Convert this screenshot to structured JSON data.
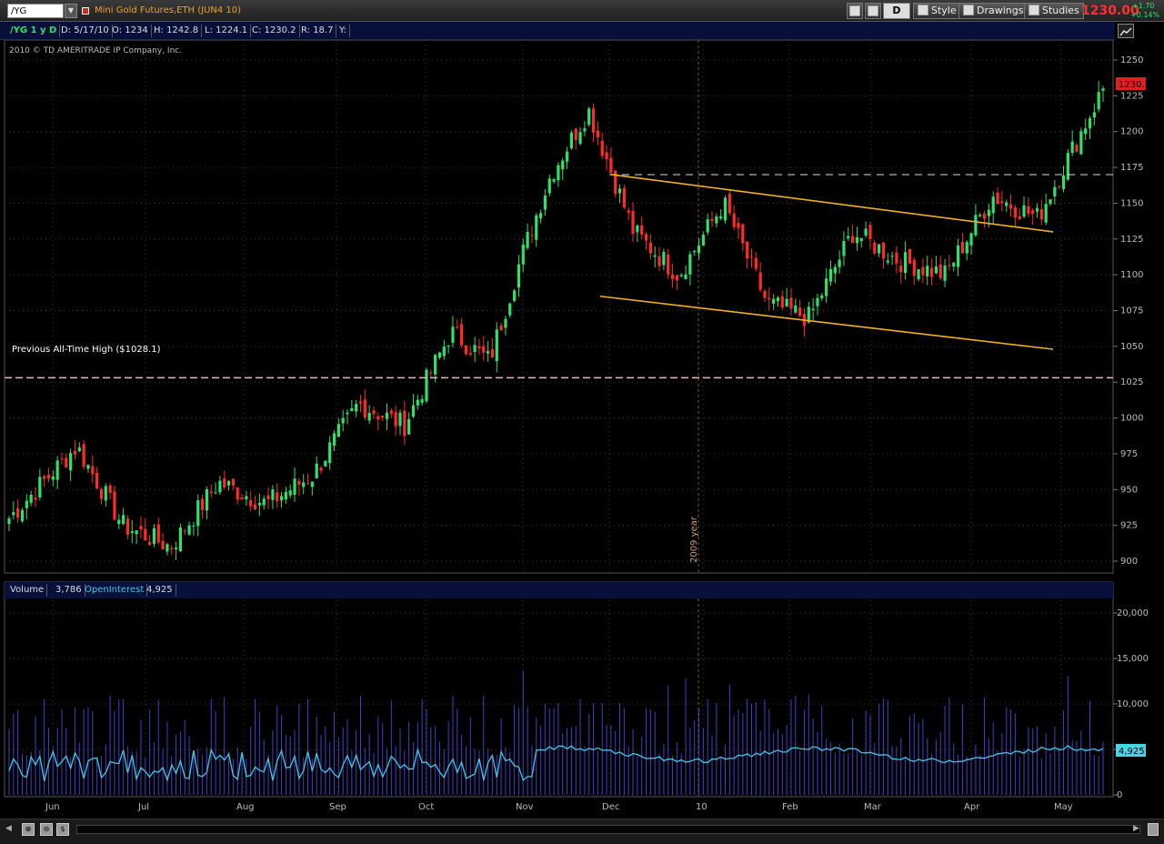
{
  "toolbar": {
    "symbol": "/YG",
    "description": "Mini Gold Futures,ETH (JUN4 10)",
    "aggregation": "D",
    "style_label": "Style",
    "drawings_label": "Drawings",
    "studies_label": "Studies",
    "last_price": "1230.00",
    "change_abs": "+1.70",
    "change_pct": "+0.14%"
  },
  "infobar": {
    "symbol_period": "/YG 1 y D",
    "date": "D: 5/17/10",
    "open": "O: 1234",
    "high": "H: 1242.8",
    "low": "L: 1224.1",
    "close": "C: 1230.2",
    "range": "R: 18.7",
    "y": "Y:"
  },
  "copyright": "2010 © TD AMERITRADE IP Company, Inc.",
  "annotations": {
    "prev_high": "Previous All-Time High ($1028.1)",
    "year_marker": "2009 year",
    "price_tag": "1230.2",
    "oi_tag": "4,925"
  },
  "volume_bar": {
    "volume_label": "Volume",
    "volume_value": "3,786",
    "oi_label": "OpenInterest",
    "oi_value": "4,925"
  },
  "colors": {
    "up": "#2ee06c",
    "down": "#ff2a2a",
    "trend": "#f0b020",
    "grid": "#3a3a3a",
    "volume": "#4040c8",
    "open_interest": "#40c8e8",
    "prev_high_line": "#ffb0b0"
  },
  "chart_data": [
    {
      "type": "candlestick",
      "ylim": [
        900,
        1250
      ],
      "y_ticks": [
        "1250",
        "1225",
        "1200",
        "1175",
        "1150",
        "1125",
        "1100",
        "1075",
        "1050",
        "1025",
        "1000",
        "975",
        "950",
        "925",
        "900"
      ],
      "x_ticks": [
        "Jun",
        "Jul",
        "Aug",
        "Sep",
        "Oct",
        "Nov",
        "Dec",
        "10",
        "Feb",
        "Mar",
        "Apr",
        "May"
      ],
      "reference_lines": [
        {
          "label": "Previous All-Time High ($1028.1)",
          "value": 1028.1
        },
        {
          "value": 1170
        }
      ],
      "trendlines": [
        {
          "from": [
            "Dec",
            1170
          ],
          "to": [
            "May",
            1130
          ]
        },
        {
          "from": [
            "Dec",
            1085
          ],
          "to": [
            "May",
            1048
          ]
        }
      ],
      "last_close": 1230.2,
      "anchors": [
        {
          "x": "Jun",
          "close": 930
        },
        {
          "x": "Jun",
          "close": 980
        },
        {
          "x": "Jul",
          "close": 925
        },
        {
          "x": "Jul",
          "close": 910
        },
        {
          "x": "Aug",
          "close": 955
        },
        {
          "x": "Aug",
          "close": 940
        },
        {
          "x": "Sep",
          "close": 960
        },
        {
          "x": "Sep",
          "close": 1010
        },
        {
          "x": "Oct",
          "close": 995
        },
        {
          "x": "Oct",
          "close": 1060
        },
        {
          "x": "Nov",
          "close": 1040
        },
        {
          "x": "Nov",
          "close": 1110
        },
        {
          "x": "Nov",
          "close": 1170
        },
        {
          "x": "Dec",
          "close": 1215
        },
        {
          "x": "Dec",
          "close": 1130
        },
        {
          "x": "10",
          "close": 1100
        },
        {
          "x": "10",
          "close": 1150
        },
        {
          "x": "Feb",
          "close": 1080
        },
        {
          "x": "Feb",
          "close": 1070
        },
        {
          "x": "Mar",
          "close": 1130
        },
        {
          "x": "Mar",
          "close": 1110
        },
        {
          "x": "Apr",
          "close": 1100
        },
        {
          "x": "Apr",
          "close": 1155
        },
        {
          "x": "May",
          "close": 1140
        },
        {
          "x": "May",
          "close": 1230
        }
      ]
    },
    {
      "type": "bar",
      "name": "Volume",
      "ylim": [
        0,
        20000
      ],
      "y_ticks": [
        "20,000",
        "15,000",
        "10,000",
        "5,000",
        "0"
      ],
      "last_value": 3786
    },
    {
      "type": "line",
      "name": "OpenInterest",
      "last_value": 4925
    }
  ]
}
